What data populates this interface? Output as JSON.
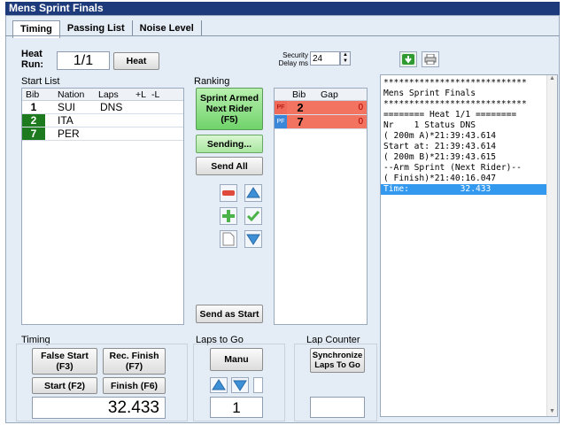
{
  "window": {
    "title": "Mens Sprint Finals"
  },
  "tabs": [
    {
      "label": "Timing"
    },
    {
      "label": "Passing List"
    },
    {
      "label": "Noise Level"
    }
  ],
  "heat": {
    "label_line1": "Heat",
    "label_line2": "Run:",
    "value": "1/1",
    "button": "Heat"
  },
  "security": {
    "label_line1": "Security",
    "label_line2": "Delay ms",
    "value": "24"
  },
  "start_list": {
    "title": "Start List",
    "headers": {
      "bib": "Bib",
      "nation": "Nation",
      "laps": "Laps",
      "plus_l": "+L",
      "minus_l": "-L"
    },
    "rows": [
      {
        "bib": "1",
        "nation": "SUI",
        "laps": "DNS",
        "bib_bg": "#ffffff",
        "bib_color": "#000000"
      },
      {
        "bib": "2",
        "nation": "ITA",
        "laps": "",
        "bib_bg": "#1e7a1e",
        "bib_color": "#ffffff"
      },
      {
        "bib": "7",
        "nation": "PER",
        "laps": "",
        "bib_bg": "#1e7a1e",
        "bib_color": "#ffffff"
      }
    ]
  },
  "ranking": {
    "title": "Ranking",
    "sprint_armed": {
      "line1": "Sprint Armed",
      "line2": "Next Rider",
      "line3": "(F5)"
    },
    "sending": "Sending...",
    "send_all": "Send All",
    "send_as_start": "Send as Start",
    "headers": {
      "bib": "Bib",
      "gap": "Gap"
    },
    "rows": [
      {
        "tag": "PF",
        "bib": "2",
        "gap": "0",
        "tag_bg": "#f06a5a",
        "tag_color": "#a00000"
      },
      {
        "tag": "PF",
        "bib": "7",
        "gap": "0",
        "tag_bg": "#3a86d8",
        "tag_color": "#ffffff"
      }
    ]
  },
  "log": {
    "lines": [
      "****************************",
      "Mens Sprint Finals",
      "****************************",
      "======== Heat 1/1 ========",
      "Nr    1 Status DNS",
      "( 200m A)*21:39:43.614",
      "Start at: 21:39:43.614",
      "( 200m B)*21:39:43.615",
      "--Arm Sprint (Next Rider)--",
      "( Finish)*21:40:16.047"
    ],
    "selected_line": "Time:          32.433"
  },
  "timing": {
    "title": "Timing",
    "false_start": {
      "line1": "False Start",
      "line2": "(F3)"
    },
    "rec_finish": {
      "line1": "Rec. Finish",
      "line2": "(F7)"
    },
    "start": "Start (F2)",
    "finish": "Finish (F6)",
    "display": "32.433"
  },
  "laps_to_go": {
    "title": "Laps to Go",
    "manu": "Manu",
    "value": "1"
  },
  "lap_counter": {
    "title": "Lap Counter",
    "sync_line1": "Synchronize",
    "sync_line2": "Laps To Go"
  }
}
